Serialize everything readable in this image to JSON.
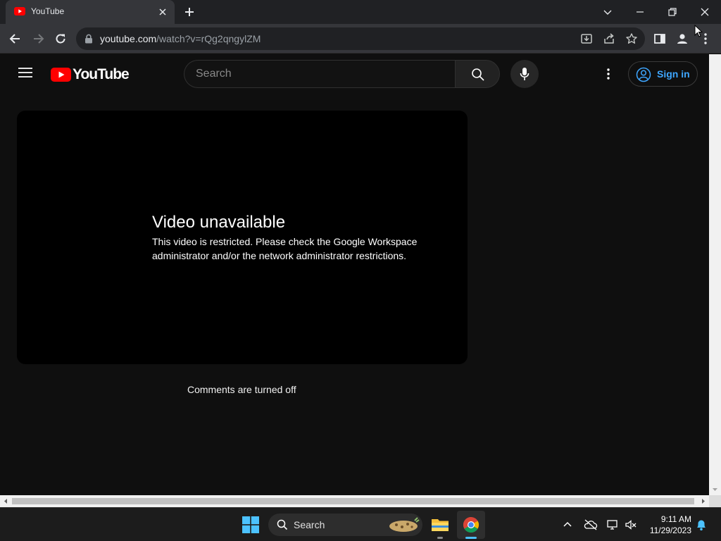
{
  "browser": {
    "tab_title": "YouTube",
    "url_domain": "youtube.com",
    "url_path": "/watch?v=rQg2qngylZM"
  },
  "youtube": {
    "logo_text": "YouTube",
    "search_placeholder": "Search",
    "sign_in_label": "Sign in",
    "player": {
      "error_title": "Video unavailable",
      "error_message": "This video is restricted. Please check the Google Workspace administrator and/or the network administrator restrictions."
    },
    "comments_status": "Comments are turned off"
  },
  "taskbar": {
    "search_label": "Search",
    "time": "9:11 AM",
    "date": "11/29/2023"
  },
  "colors": {
    "youtube_red": "#ff0000",
    "sign_in_blue": "#3ea6ff",
    "page_bg": "#0f0f0f",
    "taskbar_accent": "#4cc2ff"
  }
}
